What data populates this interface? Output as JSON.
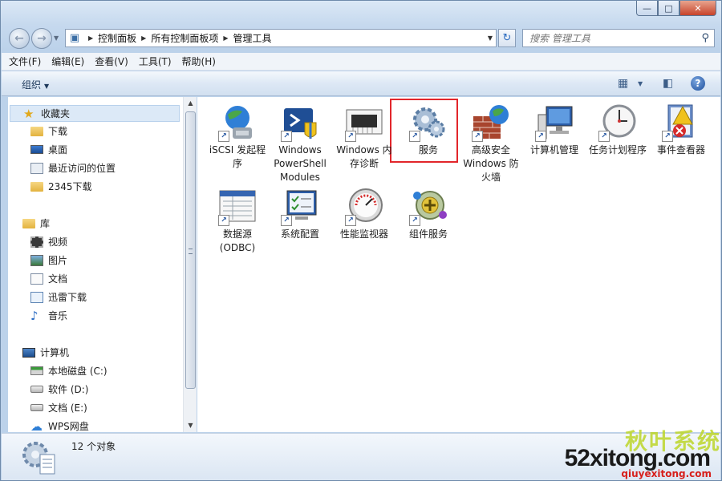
{
  "window": {
    "caption": {
      "minimize": "—",
      "maximize": "□",
      "close": "✕"
    }
  },
  "address": {
    "crumbs": [
      "控制面板",
      "所有控制面板项",
      "管理工具"
    ],
    "search_placeholder": "搜索 管理工具"
  },
  "menu": {
    "items": [
      "文件(F)",
      "编辑(E)",
      "查看(V)",
      "工具(T)",
      "帮助(H)"
    ]
  },
  "toolbar": {
    "organize": "组织",
    "help": "?"
  },
  "sidebar": {
    "favorites": {
      "label": "收藏夹",
      "items": [
        "下载",
        "桌面",
        "最近访问的位置",
        "2345下载"
      ]
    },
    "libraries": {
      "label": "库",
      "items": [
        "视频",
        "图片",
        "文档",
        "迅雷下载",
        "音乐"
      ]
    },
    "computer": {
      "label": "计算机",
      "items": [
        "本地磁盘 (C:)",
        "软件 (D:)",
        "文档 (E:)",
        "WPS网盘"
      ]
    }
  },
  "content": {
    "items": [
      {
        "label": "iSCSI 发起程序",
        "icon": "iscsi-globe-icon"
      },
      {
        "label": "Windows PowerShell Modules",
        "icon": "powershell-icon"
      },
      {
        "label": "Windows 内存诊断",
        "icon": "memory-chip-icon"
      },
      {
        "label": "服务",
        "icon": "gears-icon"
      },
      {
        "label": "高级安全 Windows 防火墙",
        "icon": "firewall-icon"
      },
      {
        "label": "计算机管理",
        "icon": "computer-management-icon"
      },
      {
        "label": "任务计划程序",
        "icon": "clock-icon"
      },
      {
        "label": "事件查看器",
        "icon": "event-viewer-icon"
      },
      {
        "label": "数据源(ODBC)",
        "icon": "odbc-icon"
      },
      {
        "label": "系统配置",
        "icon": "msconfig-icon"
      },
      {
        "label": "性能监视器",
        "icon": "gauge-icon"
      },
      {
        "label": "组件服务",
        "icon": "component-services-icon"
      }
    ]
  },
  "status": {
    "count": "12 个对象"
  },
  "watermark": {
    "chinese": "秋叶系统",
    "domain": "52xitong.com",
    "url": "qiuyexitong.com"
  },
  "colors": {
    "highlight_border": "#e2262b",
    "selection": "#dce9f7",
    "frame": "#bcd2ea"
  }
}
